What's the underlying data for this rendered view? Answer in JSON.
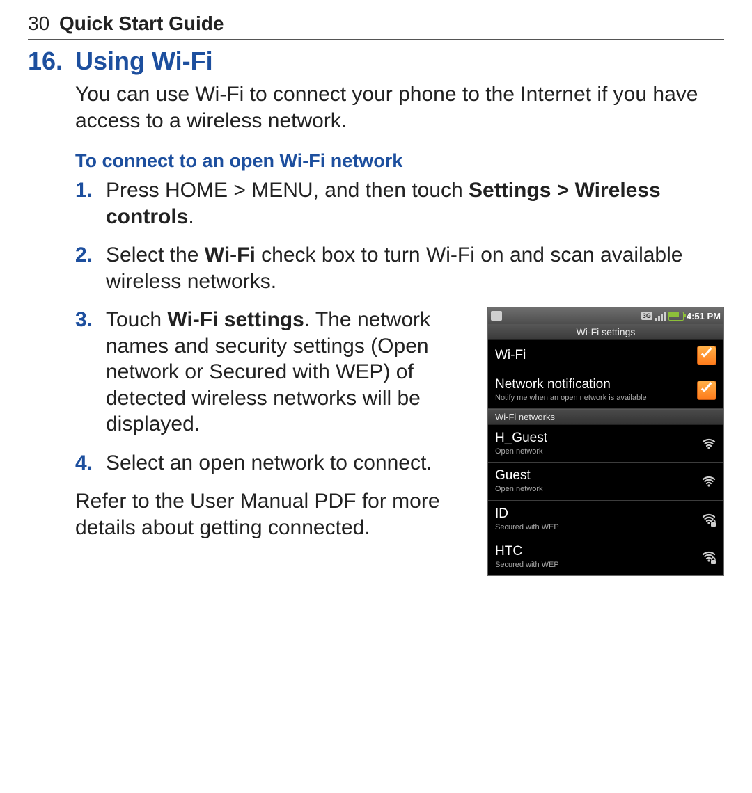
{
  "header": {
    "page_num": "30",
    "guide_title": "Quick Start Guide"
  },
  "section": {
    "number": "16.",
    "title": "Using Wi-Fi"
  },
  "intro": "You can use Wi-Fi to connect your phone to the Internet if you have access to a wireless network.",
  "subhead": "To connect to an open Wi-Fi network",
  "steps": {
    "s1_a": "Press HOME > MENU, and then touch ",
    "s1_b": "Settings > Wireless controls",
    "s1_c": ".",
    "s2_a": "Select the ",
    "s2_b": "Wi-Fi",
    "s2_c": " check box to turn Wi-Fi on and scan available wireless networks.",
    "s3_a": "Touch ",
    "s3_b": "Wi-Fi settings",
    "s3_c": ". The network names and security settings (Open network or Secured with WEP) of detected wireless networks will be displayed.",
    "s4": "Select an open network to connect."
  },
  "closing": "Refer to the User Manual PDF for more details about getting connected.",
  "phone": {
    "time": "4:51 PM",
    "title": "Wi-Fi settings",
    "rows": {
      "wifi": {
        "title": "Wi-Fi"
      },
      "notif": {
        "title": "Network notification",
        "sub": "Notify me when an open network is available"
      }
    },
    "section_label": "Wi-Fi networks",
    "networks": [
      {
        "name": "H_Guest",
        "sub": "Open network",
        "secured": false
      },
      {
        "name": "Guest",
        "sub": "Open network",
        "secured": false
      },
      {
        "name": "ID",
        "sub": "Secured with WEP",
        "secured": true
      },
      {
        "name": "HTC",
        "sub": "Secured with WEP",
        "secured": true
      }
    ]
  }
}
